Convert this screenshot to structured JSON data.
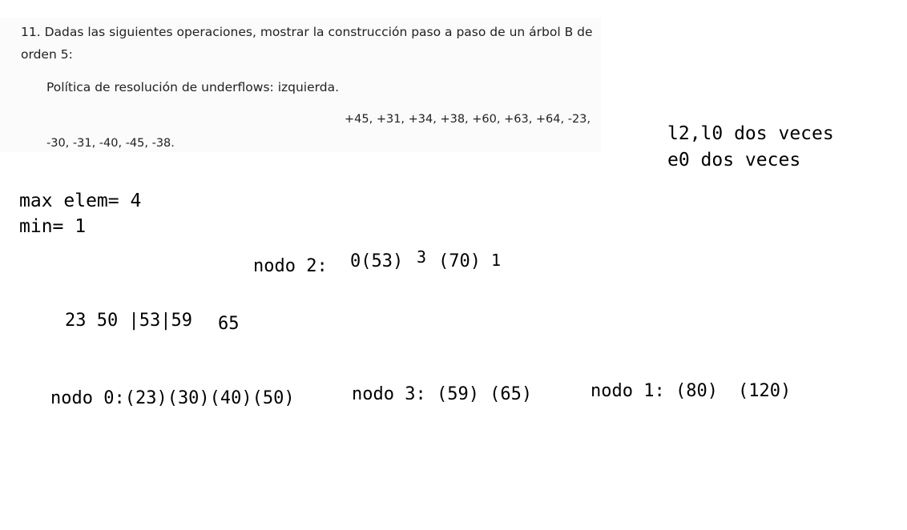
{
  "exercise": {
    "title_line1": "11. Dadas las siguientes operaciones, mostrar la construcción paso a paso de un árbol B de",
    "title_line2": "orden 5:",
    "policy": "Política de resolución de underflows: izquierda.",
    "ops_line1": "+45, +31, +34, +38, +60, +63, +64, -23,",
    "ops_line2": "-30, -31, -40, -45, -38."
  },
  "notes": {
    "l2_l0": "l2,l0 dos veces",
    "e0": "e0 dos veces",
    "max_elem": "max elem= 4",
    "min": "min= 1",
    "node2_label": "nodo 2:",
    "node2_keys": "0(53)",
    "node2_ptr3": "3",
    "node2_key70": "(70)",
    "node2_ptr1": "1",
    "scratch_main": "23 50 |53|59",
    "scratch_65": "65",
    "node0": "nodo 0:(23)(30)(40)(50)",
    "node3": "nodo 3: (59) (65)",
    "node1_label": "nodo 1: (80)",
    "node1_key120": "(120)"
  }
}
